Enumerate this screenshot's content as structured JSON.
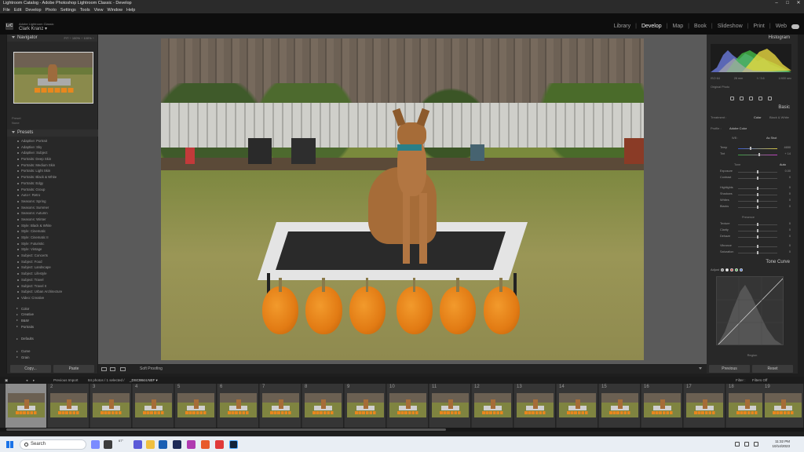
{
  "window": {
    "title": "Lightroom Catalog - Adobe Photoshop Lightroom Classic - Develop",
    "controls": [
      "–",
      "□",
      "✕"
    ]
  },
  "menu": [
    "File",
    "Edit",
    "Develop",
    "Photo",
    "Settings",
    "Tools",
    "View",
    "Window",
    "Help"
  ],
  "identity": {
    "logo": "LrC",
    "product": "Adobe Lightroom Classic",
    "user": "Clark Kranz ▾"
  },
  "modules": [
    "Library",
    "Develop",
    "Map",
    "Book",
    "Slideshow",
    "Print",
    "Web"
  ],
  "active_module": "Develop",
  "left_panel": {
    "navigator_title": "Navigator",
    "navigator_zoom": "FIT ÷ 100% ÷ 100% ÷",
    "preset_label": "Preset",
    "preset_value": "None",
    "presets_title": "Presets",
    "presets": [
      "Adaptive: Portrait",
      "Adaptive: Sky",
      "Adaptive: Subject",
      "Portraits: Deep Skin",
      "Portraits: Medium Skin",
      "Portraits: Light Skin",
      "Portraits: Black & White",
      "Portraits: Edgy",
      "Portraits: Group",
      "Auto+: Retro",
      "Seasons: Spring",
      "Seasons: Summer",
      "Seasons: Autumn",
      "Seasons: Winter",
      "Style: Black & White",
      "Style: Cinematic",
      "Style: Cinematic II",
      "Style: Futuristic",
      "Style: Vintage",
      "Subject: Concerts",
      "Subject: Food",
      "Subject: Landscape",
      "Subject: Lifestyle",
      "Subject: Travel",
      "Subject: Travel II",
      "Subject: Urban Architecture",
      "Video: Creative"
    ],
    "preset_groups": [
      "Color",
      "Creative",
      "B&W",
      "Portraits"
    ],
    "more_groups": [
      "Defaults"
    ],
    "bottom_groups": [
      "Curve",
      "Grain"
    ],
    "copy_label": "Copy...",
    "paste_label": "Paste"
  },
  "toolbar": {
    "soft_proofing": "Soft Proofing"
  },
  "right_panel": {
    "histogram_title": "Histogram",
    "hist_info": [
      "ISO 64",
      "28 mm",
      "f / 3.6",
      "1/400 sec"
    ],
    "original_photo": "Original Photo",
    "basic_title": "Basic",
    "treatment_label": "Treatment :",
    "treatment_color": "Color",
    "treatment_bw": "Black & White",
    "profile_label": "Profile :",
    "profile_value": "Adobe Color",
    "wb_label": "WB :",
    "wb_value": "As Shot",
    "temp_label": "Temp",
    "temp_value": "4650",
    "tint_label": "Tint",
    "tint_value": "+ 14",
    "tone_label": "Tone",
    "tone_auto": "Auto",
    "tone_sliders": [
      {
        "label": "Exposure",
        "value": "0.00"
      },
      {
        "label": "Contrast",
        "value": "0"
      },
      {
        "label": "Highlights",
        "value": "0"
      },
      {
        "label": "Shadows",
        "value": "0"
      },
      {
        "label": "Whites",
        "value": "0"
      },
      {
        "label": "Blacks",
        "value": "0"
      }
    ],
    "presence_label": "Presence",
    "presence_sliders": [
      {
        "label": "Texture",
        "value": "0"
      },
      {
        "label": "Clarity",
        "value": "0"
      },
      {
        "label": "Dehaze",
        "value": "0"
      },
      {
        "label": "Vibrance",
        "value": "0"
      },
      {
        "label": "Saturation",
        "value": "0"
      }
    ],
    "tone_curve_title": "Tone Curve",
    "adjust_label": "Adjust",
    "region_label": "Region",
    "previous_label": "Previous",
    "reset_label": "Reset"
  },
  "filmstrip": {
    "source": "Previous Import",
    "count": "84 photos / 1 selected /",
    "filename": "_DSC9844.NEF ▾",
    "filter_label": "Filter :",
    "filter_value": "Filters Off",
    "frames": [
      "1",
      "2",
      "3",
      "4",
      "5",
      "6",
      "7",
      "8",
      "9",
      "10",
      "11",
      "12",
      "13",
      "14",
      "15",
      "16",
      "17",
      "18",
      "19"
    ]
  },
  "taskbar": {
    "search": "Search",
    "weather": "67°",
    "time": "11:32 PM",
    "date": "10/14/2023"
  }
}
